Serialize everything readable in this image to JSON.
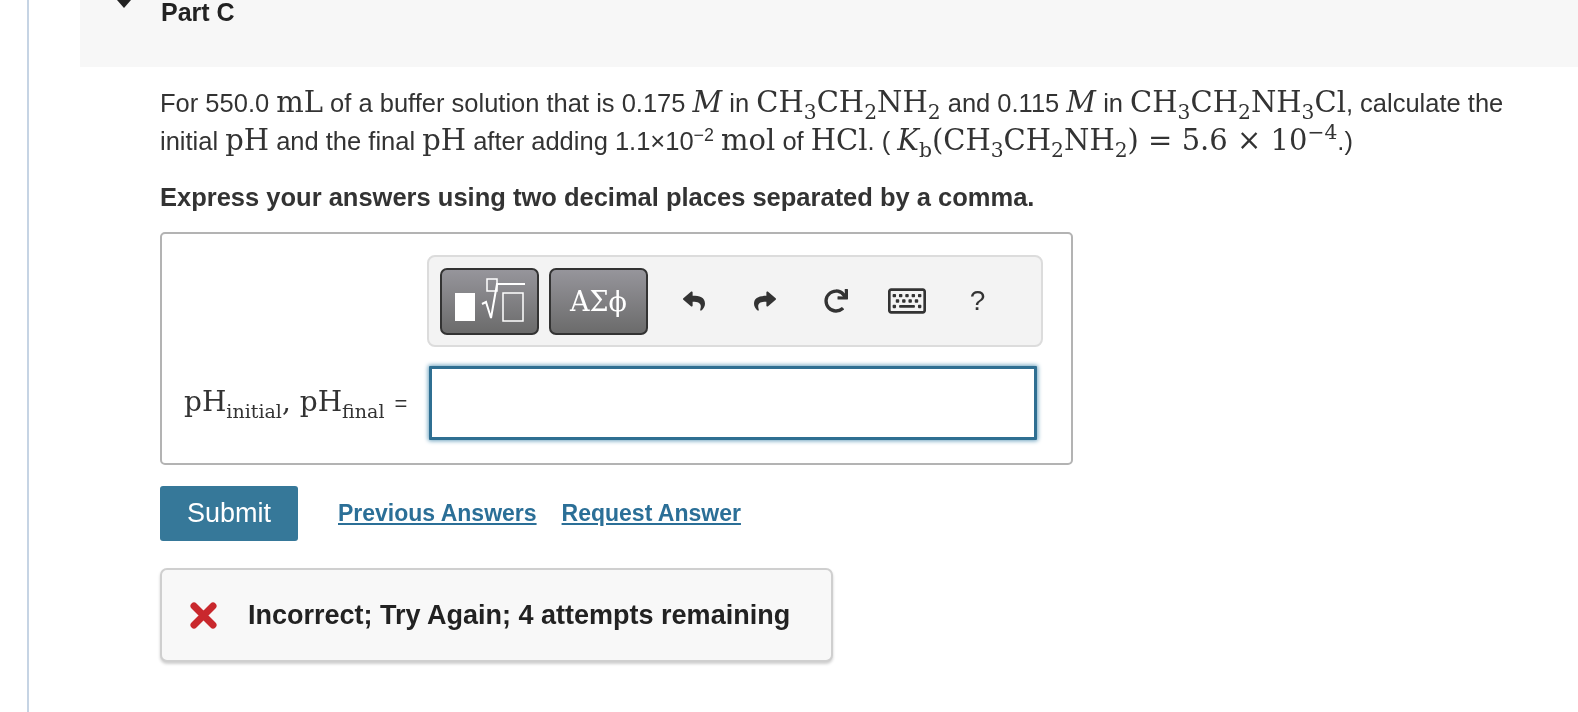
{
  "header": {
    "title": "Part C",
    "expanded": true
  },
  "problem": {
    "segments": [
      {
        "kind": "text",
        "text": "For 550.0 "
      },
      {
        "kind": "math",
        "text": "mL"
      },
      {
        "kind": "text",
        "text": " of a buffer solution that is 0.175 "
      },
      {
        "kind": "math",
        "text": "*M*"
      },
      {
        "kind": "text",
        "text": " in "
      },
      {
        "kind": "math",
        "text": "CH$_{3}$CH$_{2}$NH$_{2}$"
      },
      {
        "kind": "text",
        "text": " and 0.115 "
      },
      {
        "kind": "math",
        "text": "*M*"
      },
      {
        "kind": "text",
        "text": " in "
      },
      {
        "kind": "math",
        "text": "CH$_{3}$CH$_{2}$NH$_{3}$Cl"
      },
      {
        "kind": "text",
        "text": ", calculate the initial "
      },
      {
        "kind": "math",
        "text": "pH"
      },
      {
        "kind": "text",
        "text": " and the final "
      },
      {
        "kind": "math",
        "text": "pH"
      },
      {
        "kind": "text",
        "text": " after adding 1.1×10$^{−2}$ "
      },
      {
        "kind": "math",
        "text": "mol"
      },
      {
        "kind": "text",
        "text": " of "
      },
      {
        "kind": "math",
        "text": "HCl"
      },
      {
        "kind": "text",
        "text": ". ( "
      },
      {
        "kind": "math",
        "text": "*K*$_{b}$(CH$_{3}$CH$_{2}$NH$_{2}$) = 5.6 × 10$^{−4}$"
      },
      {
        "kind": "text",
        "text": ".)"
      }
    ]
  },
  "instruction": "Express your answers using two decimal places separated by a comma.",
  "toolbar": [
    {
      "kind": "template"
    },
    {
      "kind": "symbols",
      "label": "ΑΣϕ"
    },
    {
      "kind": "undo"
    },
    {
      "kind": "redo"
    },
    {
      "kind": "reset"
    },
    {
      "kind": "keyboard"
    },
    {
      "kind": "help",
      "label": "?"
    }
  ],
  "answer": {
    "label": "pH$_{initial}$, pH$_{final}$",
    "sign": "="
  },
  "submit": "Submit",
  "links": [
    "Previous Answers",
    "Request Answer"
  ],
  "feedback": {
    "kind": "incorrect",
    "text": "Incorrect; Try Again; 4 attempts remaining"
  }
}
